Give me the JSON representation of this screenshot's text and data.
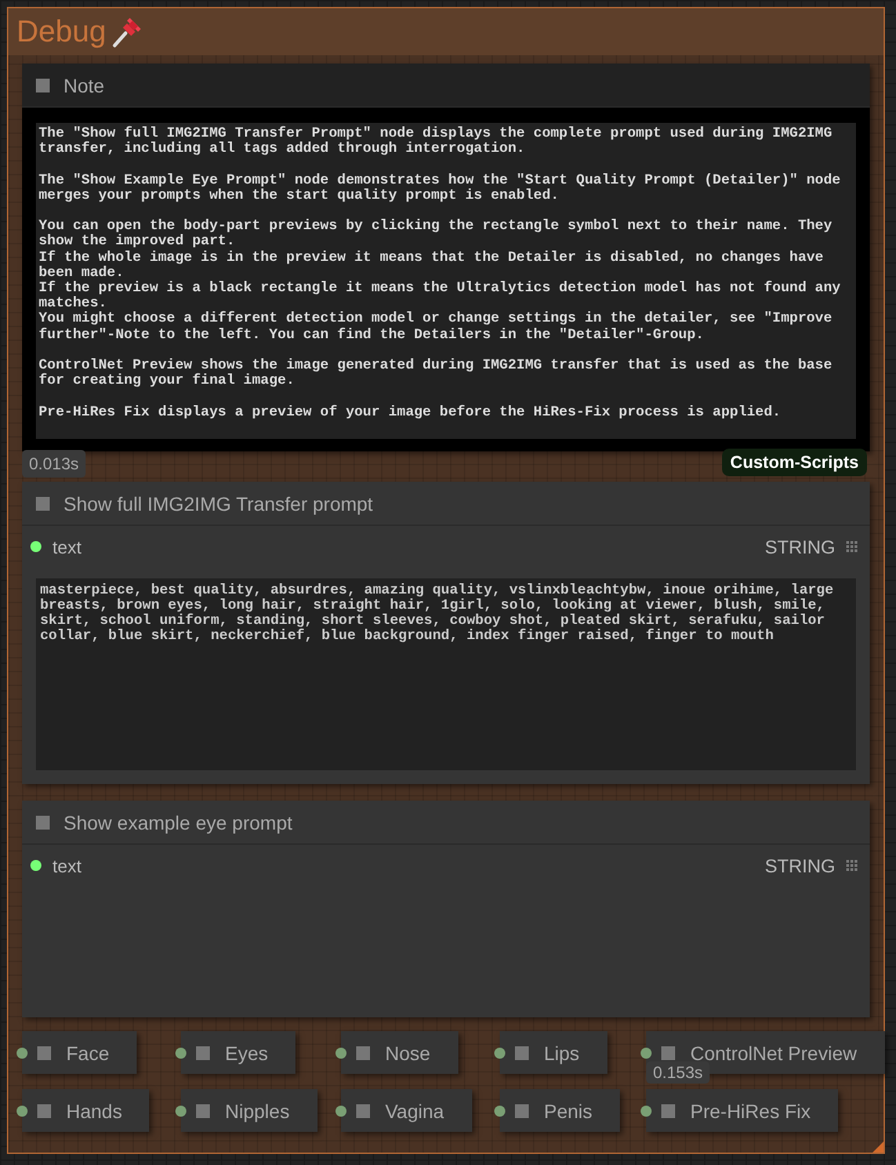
{
  "group": {
    "title": "Debug"
  },
  "note": {
    "title": "Note",
    "text": "The \"Show full IMG2IMG Transfer Prompt\" node displays the complete prompt used during IMG2IMG transfer, including all tags added through interrogation.\n\nThe \"Show Example Eye Prompt\" node demonstrates how the \"Start Quality Prompt (Detailer)\" node merges your prompts when the start quality prompt is enabled.\n\nYou can open the body-part previews by clicking the rectangle symbol next to their name. They show the improved part.\nIf the whole image is in the preview it means that the Detailer is disabled, no changes have been made.\nIf the preview is a black rectangle it means the Ultralytics detection model has not found any matches.\nYou might choose a different detection model or change settings in the detailer, see \"Improve further\"-Note to the left. You can find the Detailers in the \"Detailer\"-Group.\n\nControlNet Preview shows the image generated during IMG2IMG transfer that is used as the base for creating your final image.\n\nPre-HiRes Fix displays a preview of your image before the HiRes-Fix process is applied.",
    "time": "0.013s",
    "tag": "Custom-Scripts"
  },
  "nodes": [
    {
      "title": "Show full IMG2IMG Transfer prompt",
      "output": {
        "name": "text",
        "type": "STRING"
      },
      "value": "masterpiece, best quality, absurdres, amazing quality, vslinxbleachtybw, inoue orihime, large breasts, brown eyes, long hair, straight hair, 1girl, solo, looking at viewer, blush, smile, skirt, school uniform, standing, short sleeves, cowboy shot, pleated skirt, serafuku, sailor collar, blue skirt, neckerchief, blue background, index finger raised, finger to mouth"
    },
    {
      "title": "Show example eye prompt",
      "output": {
        "name": "text",
        "type": "STRING"
      }
    }
  ],
  "previews": [
    [
      {
        "title": "Face"
      },
      {
        "title": "Eyes"
      },
      {
        "title": "Nose"
      },
      {
        "title": "Lips"
      },
      {
        "title": "ControlNet Preview",
        "time": "0.153s"
      }
    ],
    [
      {
        "title": "Hands"
      },
      {
        "title": "Nipples"
      },
      {
        "title": "Vagina"
      },
      {
        "title": "Penis"
      },
      {
        "title": "Pre-HiRes Fix"
      }
    ]
  ]
}
